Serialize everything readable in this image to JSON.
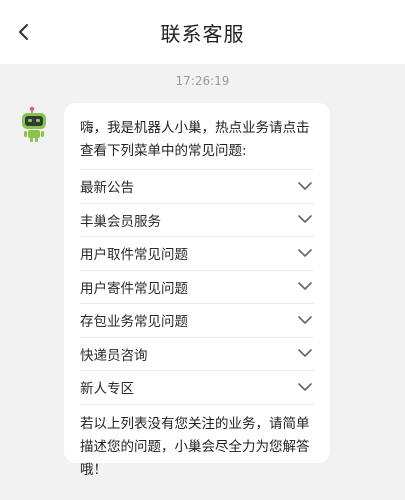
{
  "header": {
    "title": "联系客服"
  },
  "chat": {
    "timestamp": "17:26:19",
    "message": {
      "intro": "嗨，我是机器人小巢，热点业务请点击查看下列菜单中的常见问题:",
      "menu": [
        {
          "label": "最新公告"
        },
        {
          "label": "丰巢会员服务"
        },
        {
          "label": "用户取件常见问题"
        },
        {
          "label": "用户寄件常见问题"
        },
        {
          "label": "存包业务常见问题"
        },
        {
          "label": "快递员咨询"
        },
        {
          "label": "新人专区"
        }
      ],
      "outro": "若以上列表没有您关注的业务，请简单描述您的问题，小巢会尽全力为您解答哦！"
    }
  },
  "icons": {
    "back": "chevron-left-icon",
    "expand": "chevron-down-icon",
    "avatar": "robot-avatar"
  },
  "colors": {
    "background": "#f2f2f2",
    "bubble": "#ffffff",
    "robot_green": "#8bc34a",
    "robot_dark": "#2f3a3a",
    "robot_accent": "#e0607a"
  }
}
